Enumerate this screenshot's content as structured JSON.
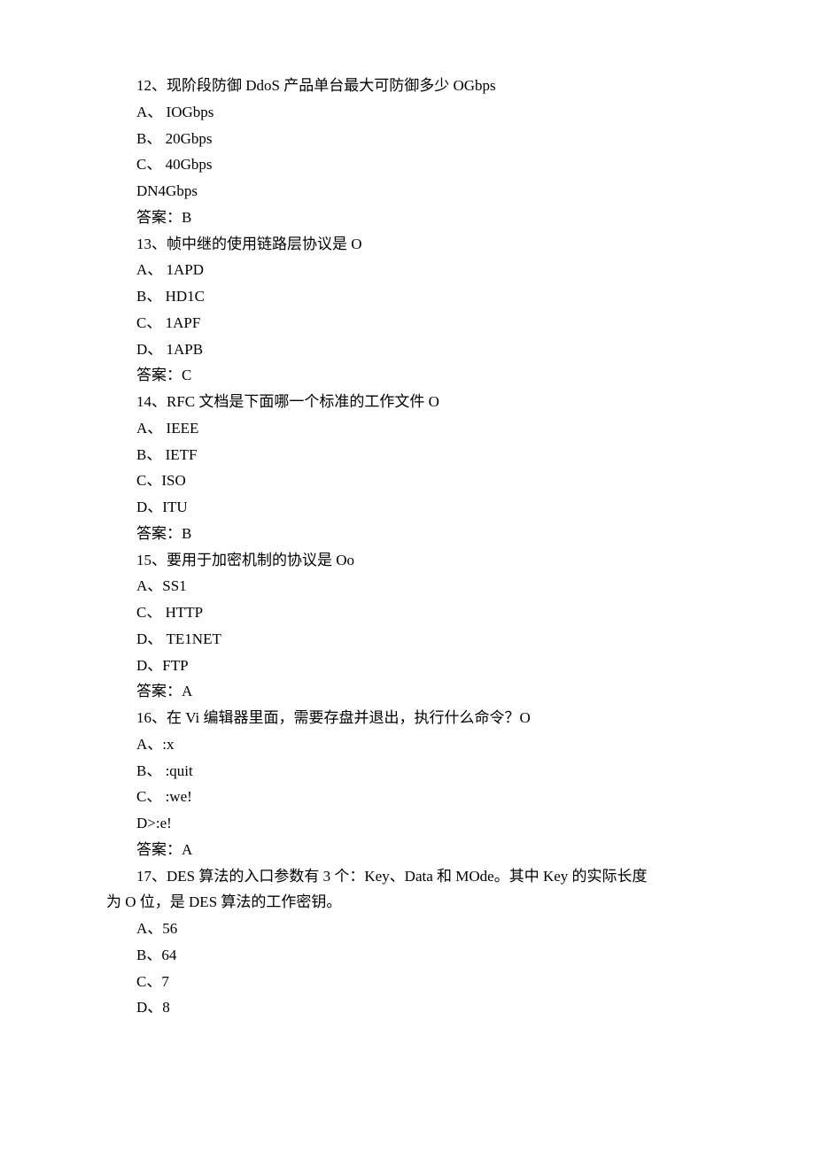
{
  "lines": [
    "12、现阶段防御 DdoS 产品单台最大可防御多少 OGbps",
    "A、 IOGbps",
    "B、 20Gbps",
    "C、 40Gbps",
    "DN4Gbps",
    "答案：B",
    "13、帧中继的使用链路层协议是 O",
    "A、 1APD",
    "B、 HD1C",
    "C、 1APF",
    "D、 1APB",
    "答案：C",
    "14、RFC 文档是下面哪一个标准的工作文件 O",
    "A、 IEEE",
    "B、 IETF",
    "C、ISO",
    "D、ITU",
    "答案：B",
    "15、要用于加密机制的协议是 Oo",
    "A、SS1",
    "C、 HTTP",
    "D、 TE1NET",
    "D、FTP",
    "答案：A",
    "16、在 Vi 编辑器里面，需要存盘并退出，执行什么命令？O",
    "A、:x",
    "B、 :quit",
    "C、 :we!",
    "D>:e!",
    "答案：A",
    "17、DES 算法的入口参数有 3 个：Key、Data 和 MOde。其中 Key 的实际长度"
  ],
  "wrapLine": "为 O 位，是 DES 算法的工作密钥。",
  "tailLines": [
    "A、56",
    "B、64",
    "C、7",
    "D、8"
  ]
}
